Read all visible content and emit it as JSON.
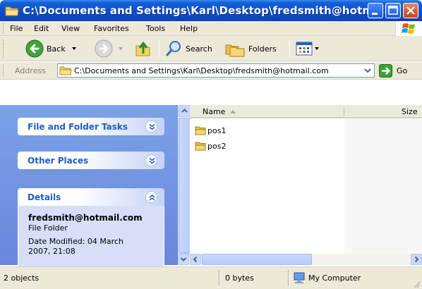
{
  "window": {
    "title": "C:\\Documents and Settings\\Karl\\Desktop\\fredsmith@hotmail...",
    "title_color": "#0a4fd0"
  },
  "menu": {
    "items": [
      "File",
      "Edit",
      "View",
      "Favorites",
      "Tools",
      "Help"
    ]
  },
  "toolbar": {
    "back_label": "Back",
    "search_label": "Search",
    "folders_label": "Folders"
  },
  "address": {
    "label": "Address",
    "value": "C:\\Documents and Settings\\Karl\\Desktop\\fredsmith@hotmail.com",
    "go_label": "Go"
  },
  "taskpane": {
    "panels": [
      {
        "title": "File and Folder Tasks",
        "state": "collapsed"
      },
      {
        "title": "Other Places",
        "state": "collapsed"
      },
      {
        "title": "Details",
        "state": "expanded"
      }
    ],
    "details": {
      "name": "fredsmith@hotmail.com",
      "type": "File Folder",
      "modified_line1": "Date Modified: 04 March",
      "modified_line2": "2007, 21:08"
    }
  },
  "listview": {
    "columns": [
      "Name",
      "Size"
    ],
    "items": [
      {
        "name": "pos1",
        "icon": "folder-icon"
      },
      {
        "name": "pos2",
        "icon": "folder-icon"
      }
    ]
  },
  "statusbar": {
    "objects": "2 objects",
    "size": "0 bytes",
    "zone": "My Computer"
  }
}
